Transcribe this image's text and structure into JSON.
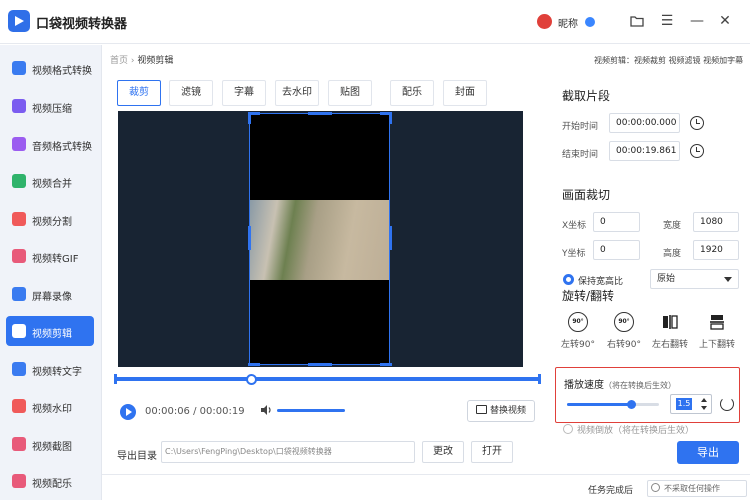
{
  "app": {
    "title": "口袋视频转换器",
    "username": "昵称"
  },
  "colors": {
    "accent": "#2f73f0",
    "highlight_border": "#e0403a",
    "preview_bg": "#182433"
  },
  "sidebar": {
    "items": [
      {
        "label": "视频格式转换",
        "icon": "video-convert-icon",
        "color": "#3a7bf0"
      },
      {
        "label": "视频压缩",
        "icon": "compress-icon",
        "color": "#7b5cf0"
      },
      {
        "label": "音频格式转换",
        "icon": "audio-icon",
        "color": "#9b5cf0"
      },
      {
        "label": "视频合并",
        "icon": "merge-icon",
        "color": "#2fb36b"
      },
      {
        "label": "视频分割",
        "icon": "split-icon",
        "color": "#f05a5a"
      },
      {
        "label": "视频转GIF",
        "icon": "gif-icon",
        "color": "#e85a7a"
      },
      {
        "label": "屏幕录像",
        "icon": "record-icon",
        "color": "#3a7bf0"
      },
      {
        "label": "视频剪辑",
        "icon": "edit-icon",
        "color": "#ffffff",
        "active": true
      },
      {
        "label": "视频转文字",
        "icon": "text-icon",
        "color": "#3a7bf0"
      },
      {
        "label": "视频水印",
        "icon": "watermark-icon",
        "color": "#f05a5a"
      },
      {
        "label": "视频截图",
        "icon": "screenshot-icon",
        "color": "#e85a7a"
      },
      {
        "label": "视频配乐",
        "icon": "music-icon",
        "color": "#e85a7a"
      }
    ]
  },
  "breadcrumb": {
    "home": "首页",
    "sep": "›",
    "current": "视频剪辑"
  },
  "quick_links": "视频剪辑：视频裁剪  视频滤镜  视频加字幕",
  "tabs": [
    "裁剪",
    "滤镜",
    "字幕",
    "去水印",
    "贴图",
    "配乐",
    "封面"
  ],
  "player": {
    "time": "00:00:06 / 00:00:19",
    "replace_label": "替换视频"
  },
  "output": {
    "dir_label": "导出目录",
    "path": "C:\\Users\\FengPing\\Desktop\\口袋视频转换器",
    "change_label": "更改",
    "open_label": "打开",
    "export_label": "导出"
  },
  "status": {
    "task_done_label": "任务完成后",
    "after_action": "不采取任何操作"
  },
  "clip": {
    "title": "截取片段",
    "start_label": "开始时间",
    "start_value": "00:00:00.000",
    "end_label": "结束时间",
    "end_value": "00:00:19.861"
  },
  "crop": {
    "title": "画面裁切",
    "x_label": "X坐标",
    "x_value": "0",
    "w_label": "宽度",
    "w_value": "1080",
    "y_label": "Y坐标",
    "y_value": "0",
    "h_label": "高度",
    "h_value": "1920",
    "keep_ratio_label": "保持宽高比",
    "ratio_value": "原始"
  },
  "rotate": {
    "title": "旋转/翻转",
    "left_label": "左转90°",
    "left_badge": "90°",
    "right_label": "右转90°",
    "right_badge": "90°",
    "hflip_label": "左右翻转",
    "vflip_label": "上下翻转"
  },
  "speed": {
    "title": "播放速度",
    "note": "（将在转换后生效）",
    "value": "1.5",
    "level": 0.7
  },
  "reverse": {
    "label": "视频倒放（将在转换后生效）"
  }
}
